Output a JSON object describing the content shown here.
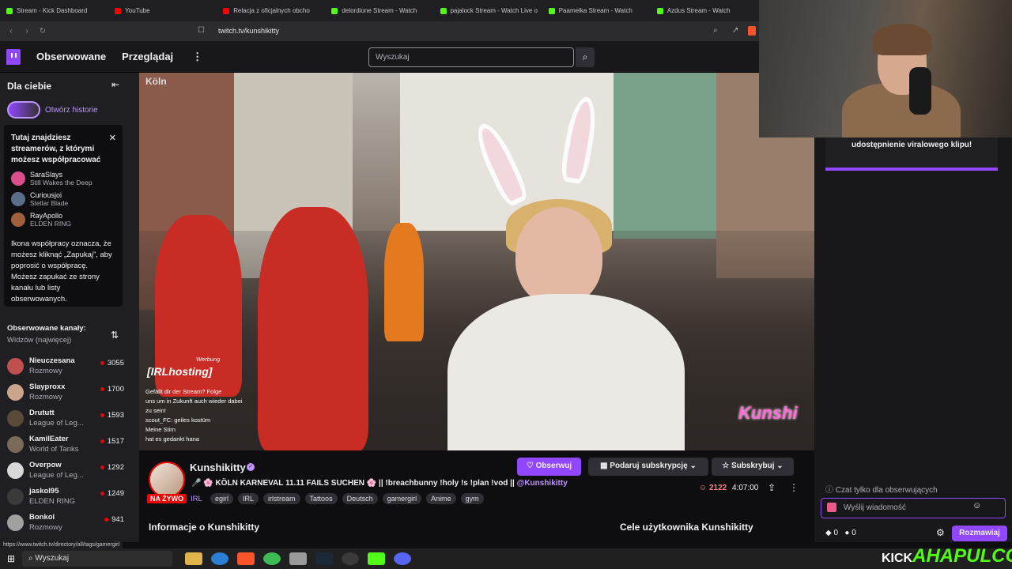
{
  "browser": {
    "tabs": [
      {
        "label": "Stream - Kick Dashboard",
        "color": "#53fc18"
      },
      {
        "label": "YouTube",
        "color": "#ff0000"
      },
      {
        "label": "Relacja z oficjalnych obcho",
        "color": "#ff0000"
      },
      {
        "label": "delordione Stream - Watch",
        "color": "#53fc18"
      },
      {
        "label": "pajalock Stream - Watch Live o",
        "color": "#53fc18"
      },
      {
        "label": "Paamelka Stream - Watch",
        "color": "#53fc18"
      },
      {
        "label": "Azdus Stream - Watch",
        "color": "#53fc18"
      }
    ],
    "url": "twitch.tv/kunshikitty"
  },
  "topnav": {
    "followed": "Obserwowane",
    "browse": "Przeglądaj",
    "search_placeholder": "Wyszukaj"
  },
  "sidebar": {
    "title": "Dla ciebie",
    "stories_label": "Otwórz historie",
    "popup": {
      "title": "Tutaj znajdziesz streamerów, z którymi możesz współpracować",
      "streamers": [
        {
          "name": "SaraSlays",
          "game": "Still Wakes the Deep"
        },
        {
          "name": "Curiousjoi",
          "game": "Stellar Blade"
        },
        {
          "name": "RayApollo",
          "game": "ELDEN RING"
        }
      ],
      "body": "Ikona współpracy oznacza, że możesz kliknąć „Zapukaj”, aby poprosić o współpracę. Możesz zapukać ze strony kanału lub listy obserwowanych."
    },
    "followed_title": "Obserwowane kanały:",
    "followed_sort": "Widzów (najwięcej)",
    "channels": [
      {
        "name": "Nieuczesana",
        "game": "Rozmowy",
        "viewers": "3055",
        "color": "#c0504d"
      },
      {
        "name": "Slayproxx",
        "game": "Rozmowy",
        "viewers": "1700",
        "color": "#caa58a"
      },
      {
        "name": "Drututt",
        "game": "League of Leg...",
        "viewers": "1593",
        "color": "#5a4a3a"
      },
      {
        "name": "KamilEater",
        "game": "World of Tanks",
        "viewers": "1517",
        "color": "#7a6a5a"
      },
      {
        "name": "Overpow",
        "game": "League of Leg...",
        "viewers": "1292",
        "color": "#d8d8d8"
      },
      {
        "name": "jaskol95",
        "game": "ELDEN RING",
        "viewers": "1249",
        "color": "#3a3a3a"
      },
      {
        "name": "Bonkol",
        "game": "Rozmowy",
        "viewers": "941",
        "color": "#a0a0a0"
      }
    ]
  },
  "video": {
    "location": "Köln",
    "werbung": "Werbung",
    "irl_hosting": "[IRLhosting]",
    "chat_lines": [
      "Gefällt dir der Stream? Folge",
      "uns um in Zukunft auch wieder dabei",
      "zu sein!",
      "scout_FC: geiles kostüm",
      "Meine Stirn",
      "hat es gedankt hana"
    ],
    "logo_text": "Kunshi"
  },
  "stream_info": {
    "channel_name": "Kunshikitty",
    "live_badge": "NA ŻYWO",
    "title_text": "🎤 🌸 KÖLN KARNEVAL 11.11 FAILS SUCHEN 🌸 || !breachbunny !holy !s !plan !vod ||",
    "title_handle": "@Kunshikitty",
    "category": "IRL",
    "tags": [
      "egirl",
      "IRL",
      "irlstream",
      "Tattoos",
      "Deutsch",
      "gamergirl",
      "Anime",
      "gym"
    ],
    "follow_label": "Obserwuj",
    "gift_label": "Podaruj subskrypcję",
    "subscribe_label": "Subskrybuj",
    "viewers": "2122",
    "uptime": "4:07:00",
    "about_title": "Informacje o Kunshikitty",
    "goals_title": "Cele użytkownika Kunshikitty"
  },
  "chat": {
    "pinned": "udostępnienie viralowego klipu!",
    "followers_only": "Czat tylko dla obserwujących",
    "input_placeholder": "Wyślij wiadomość",
    "points_a": "0",
    "points_b": "0",
    "send_label": "Rozmawiaj"
  },
  "status_url": "https://www.twitch.tv/directory/all/tags/gamergirl",
  "taskbar": {
    "search_placeholder": "Wyszukaj",
    "brand_prefix": "KICK",
    "brand_name": "AHAPULCO"
  }
}
